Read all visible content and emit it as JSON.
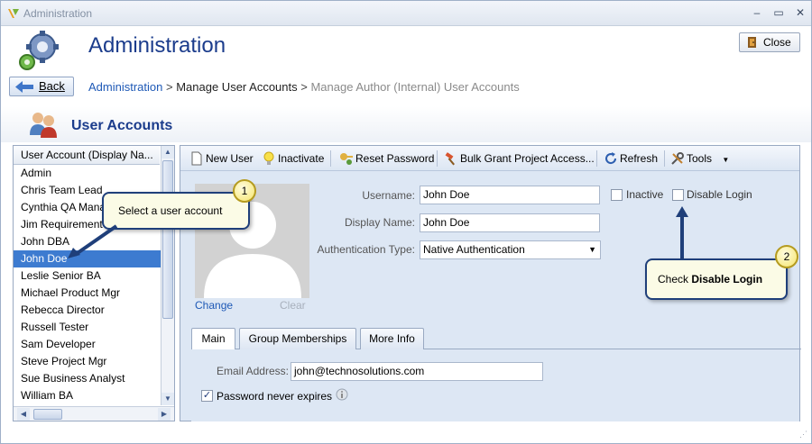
{
  "window": {
    "title": "Administration"
  },
  "header": {
    "title": "Administration",
    "close_label": "Close",
    "back_label": "Back"
  },
  "breadcrumb": {
    "item1": "Administration",
    "sep": ">",
    "item2": "Manage User Accounts",
    "item3": "Manage Author (Internal) User Accounts"
  },
  "section": {
    "title": "User Accounts"
  },
  "user_list": {
    "header": "User Account (Display Na...",
    "items": [
      "Admin",
      "Chris Team Lead",
      "Cynthia QA Mana",
      "Jim Requirement",
      "John DBA",
      "John Doe",
      "Leslie Senior BA",
      "Michael Product Mgr",
      "Rebecca Director",
      "Russell Tester",
      "Sam Developer",
      "Steve Project Mgr",
      "Sue Business Analyst",
      "William BA"
    ],
    "selected": "John Doe"
  },
  "toolbar": {
    "new_user": "New User",
    "inactivate": "Inactivate",
    "reset_password": "Reset Password",
    "bulk_grant": "Bulk Grant Project Access...",
    "refresh": "Refresh",
    "tools": "Tools"
  },
  "photo": {
    "change": "Change",
    "clear": "Clear"
  },
  "form": {
    "username_label": "Username:",
    "username_value": "John Doe",
    "display_label": "Display Name:",
    "display_value": "John Doe",
    "auth_label": "Authentication Type:",
    "auth_value": "Native Authentication",
    "inactive_label": "Inactive",
    "inactive_checked": false,
    "disable_login_label": "Disable Login",
    "disable_login_checked": false
  },
  "tabs": {
    "main": "Main",
    "groups": "Group Memberships",
    "more": "More Info",
    "active": "Main"
  },
  "main_tab": {
    "email_label": "Email Address:",
    "email_value": "john@technosolutions.com",
    "pw_never_expires_label": "Password never expires",
    "pw_never_expires_checked": true
  },
  "callouts": {
    "one": {
      "number": "1",
      "text": "Select a user account"
    },
    "two": {
      "number": "2",
      "prefix": "Check ",
      "bold": "Disable Login"
    }
  },
  "colors": {
    "accent": "#1b3c8c",
    "selection": "#3d7bd0",
    "link": "#1e59b6",
    "callout_border": "#1f3f7a"
  }
}
